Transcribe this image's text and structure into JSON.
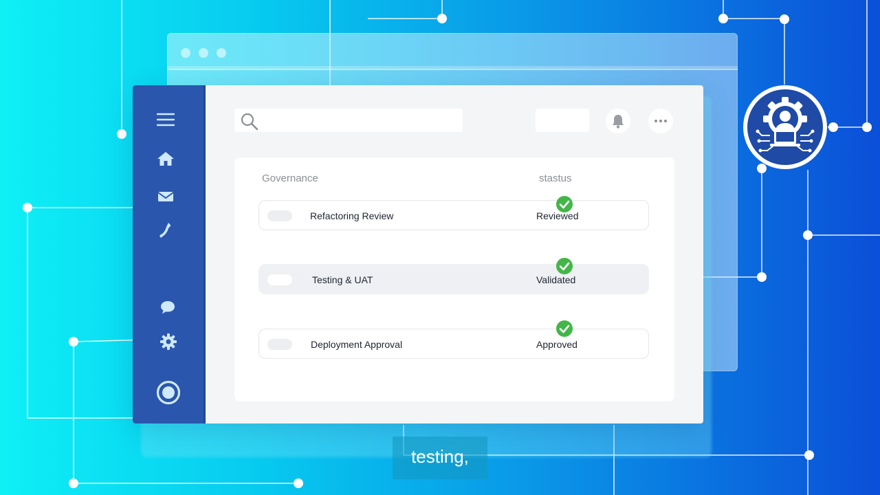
{
  "search": {
    "value": "",
    "placeholder": ""
  },
  "table": {
    "headers": {
      "name": "Governance",
      "status": "stastus"
    },
    "rows": [
      {
        "name": "Refactoring Review",
        "status": "Reviewed"
      },
      {
        "name": "Testing & UAT",
        "status": "Validated"
      },
      {
        "name": "Deployment Approval",
        "status": "Approved"
      }
    ]
  },
  "subtitle": "testing,",
  "icons": {
    "sidebar": [
      "menu-icon",
      "home-icon",
      "mail-icon",
      "phone-icon",
      "chat-icon",
      "settings-icon",
      "record-icon"
    ],
    "toolbar": [
      "search-icon",
      "bell-icon",
      "more-icon"
    ],
    "badge": "gear-person-laptop-icon",
    "status": "check-icon"
  },
  "colors": {
    "sidebar": "#2a56ad",
    "check": "#44b649",
    "badge": "#1f4aa6",
    "background_start": "#0ef0f6",
    "background_end": "#0b4fd8"
  }
}
